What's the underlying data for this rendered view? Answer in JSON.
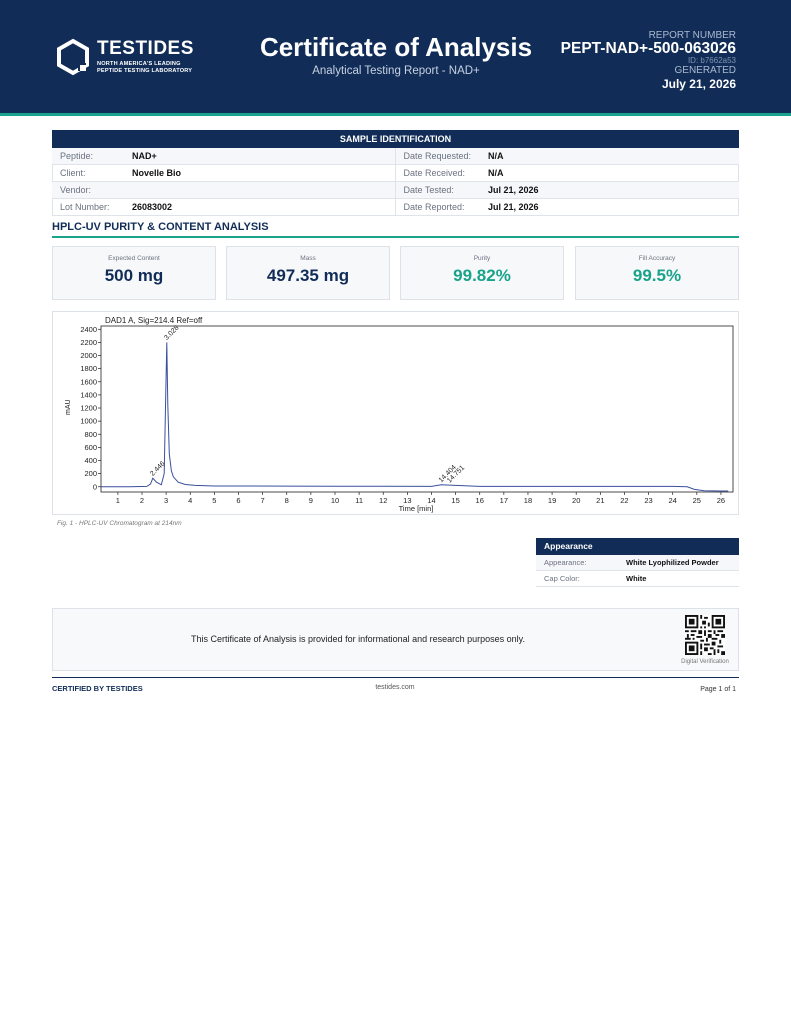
{
  "header": {
    "brand": "TESTIDES",
    "tagline_1": "NORTH AMERICA'S LEADING",
    "tagline_2": "PEPTIDE TESTING LABORATORY",
    "title": "Certificate of Analysis",
    "subtitle": "Analytical Testing Report  -  NAD+",
    "report_number_label": "REPORT NUMBER",
    "report_number": "PEPT-NAD+-500-063026",
    "report_id": "ID: b7662a53",
    "generated_label": "GENERATED",
    "generated_date": "July 21, 2026",
    "brand_color": "#112d57",
    "accent_color": "#19a38a",
    "logo_icon": "hexagon-logo-icon"
  },
  "sample_identification": {
    "heading": "SAMPLE IDENTIFICATION",
    "rows": [
      {
        "left_label": "Peptide:",
        "left_value": "NAD+",
        "right_label": "Date Requested:",
        "right_value": "N/A"
      },
      {
        "left_label": "Client:",
        "left_value": "Novelle Bio",
        "right_label": "Date Received:",
        "right_value": "N/A"
      },
      {
        "left_label": "Vendor:",
        "left_value": "",
        "right_label": "Date Tested:",
        "right_value": "Jul 21, 2026"
      },
      {
        "left_label": "Lot Number:",
        "left_value": "26083002",
        "right_label": "Date Reported:",
        "right_value": "Jul 21, 2026"
      }
    ]
  },
  "hplc": {
    "section_title": "HPLC-UV PURITY & CONTENT ANALYSIS",
    "metrics": [
      {
        "label": "Expected Content",
        "value": "500 mg"
      },
      {
        "label": "Mass",
        "value": "497.35 mg"
      },
      {
        "label": "Purity",
        "value": "99.82%"
      },
      {
        "label": "Fill Accuracy",
        "value": "99.5%"
      }
    ],
    "figure_caption": "Fig. 1  -  HPLC-UV Chromatogram at 214nm"
  },
  "chart_data": {
    "type": "line",
    "title": "DAD1 A, Sig=214.4 Ref=off",
    "xlabel": "Time [min]",
    "ylabel": "mAU",
    "xlim": [
      0.3,
      26.5
    ],
    "ylim": [
      -80,
      2450
    ],
    "x_ticks": [
      1,
      2,
      3,
      4,
      5,
      6,
      7,
      8,
      9,
      10,
      11,
      12,
      13,
      14,
      15,
      16,
      17,
      18,
      19,
      20,
      21,
      22,
      23,
      24,
      25,
      26
    ],
    "y_ticks": [
      0,
      200,
      400,
      600,
      800,
      1000,
      1200,
      1400,
      1600,
      1800,
      2000,
      2200,
      2400
    ],
    "series": [
      {
        "x": [
          0.3,
          1.5,
          2.2,
          2.35,
          2.446,
          2.6,
          2.8,
          2.92,
          2.98,
          3.028,
          3.07,
          3.13,
          3.22,
          3.3,
          3.5,
          3.8,
          4.2,
          5,
          6,
          8,
          10,
          12,
          14,
          14.404,
          14.751,
          16,
          20,
          24,
          24.6,
          24.9,
          25.3,
          26,
          26.3
        ],
        "y": [
          0,
          0,
          5,
          40,
          130,
          70,
          30,
          200,
          1300,
          2200,
          1250,
          500,
          240,
          150,
          70,
          35,
          20,
          12,
          12,
          10,
          8,
          8,
          5,
          30,
          25,
          5,
          5,
          5,
          0,
          -40,
          -60,
          -65,
          -65
        ]
      }
    ],
    "peak_labels": [
      {
        "x": 2.446,
        "y": 130,
        "text": "2.446"
      },
      {
        "x": 3.028,
        "y": 2200,
        "text": "3.028"
      },
      {
        "x": 14.404,
        "y": 30,
        "text": "14.404"
      },
      {
        "x": 14.751,
        "y": 25,
        "text": "14.751"
      }
    ],
    "grid": false,
    "line_color": "#3a4fa0"
  },
  "appearance": {
    "heading": "Appearance",
    "rows": [
      {
        "label": "Appearance:",
        "value": "White Lyophilized Powder"
      },
      {
        "label": "Cap Color:",
        "value": "White"
      }
    ]
  },
  "disclaimer": {
    "text": "This Certificate of Analysis is provided for informational and research purposes only.",
    "verification_label": "Digital Verification",
    "qr_icon": "qr-code-icon"
  },
  "footer": {
    "left": "CERTIFIED BY TESTIDES",
    "center": "testides.com",
    "right": "Page 1 of 1"
  }
}
